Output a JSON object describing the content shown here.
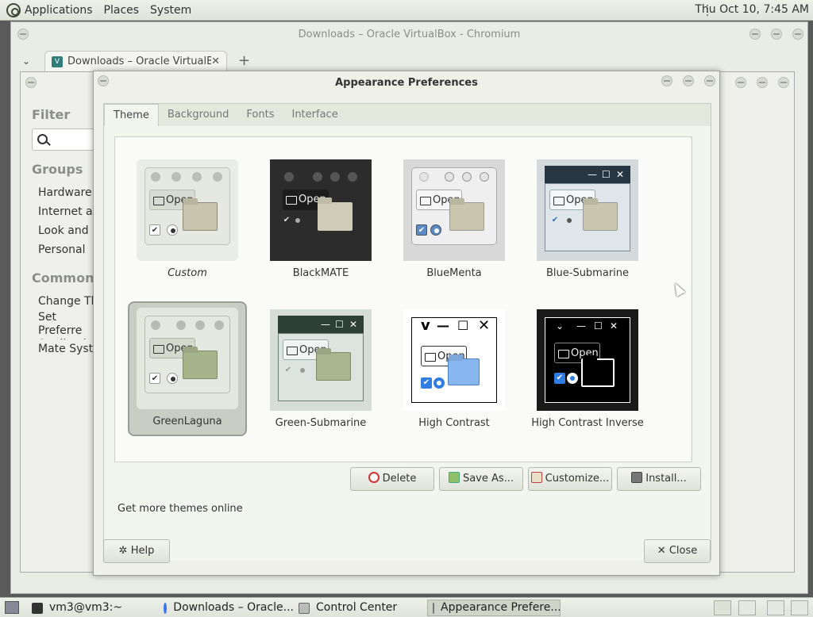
{
  "top_panel": {
    "menu": [
      "Applications",
      "Places",
      "System"
    ],
    "clock": "Thu Oct 10,  7:45 AM"
  },
  "chromium": {
    "title": "Downloads – Oracle VirtualBox - Chromium",
    "tab_title": "Downloads – Oracle VirtualB",
    "favicon": "V",
    "tab_close": "✕",
    "tab_menu": "⌄",
    "new_tab": "+"
  },
  "control_center": {
    "filter_heading": "Filter",
    "groups_heading": "Groups",
    "groups": [
      "Hardware",
      "Internet and",
      "Look and Fe",
      "Personal"
    ],
    "common_heading": "Common Ta",
    "common": [
      "Change The",
      "Set Preferre Applications",
      "Mate System"
    ]
  },
  "dialog": {
    "title": "Appearance Preferences",
    "tabs": [
      "Theme",
      "Background",
      "Fonts",
      "Interface"
    ],
    "themes": [
      {
        "name": "Custom",
        "style": "custom"
      },
      {
        "name": "BlackMATE",
        "style": "blackmate"
      },
      {
        "name": "BlueMenta",
        "style": "bluementa"
      },
      {
        "name": "Blue-Submarine",
        "style": "bluesub"
      },
      {
        "name": "GreenLaguna",
        "style": "greenlaguna"
      },
      {
        "name": "Green-Submarine",
        "style": "greensub"
      },
      {
        "name": "High Contrast",
        "style": "hc"
      },
      {
        "name": "High Contrast Inverse",
        "style": "hci"
      }
    ],
    "thumb_open_label": "Open",
    "selected_theme": "GreenLaguna",
    "actions": {
      "delete": "Delete",
      "save_as": "Save As...",
      "customize": "Customize...",
      "install": "Install..."
    },
    "more_themes": "Get more themes online",
    "help": "Help",
    "close": "Close",
    "icons": {
      "help": "✲",
      "close": "✕"
    }
  },
  "taskbar": {
    "items": [
      {
        "label": "vm3@vm3:~",
        "icon": "terminal-icon"
      },
      {
        "label": "Downloads – Oracle...",
        "icon": "chromium-icon"
      },
      {
        "label": "Control Center",
        "icon": "control-center-icon"
      },
      {
        "label": "Appearance Prefere...",
        "icon": "appearance-icon",
        "active": true
      }
    ]
  },
  "colors": {
    "panel_bg": "#e6e9e1",
    "dialog_bg": "#eef0e9",
    "selection": "#c9cdc4"
  }
}
